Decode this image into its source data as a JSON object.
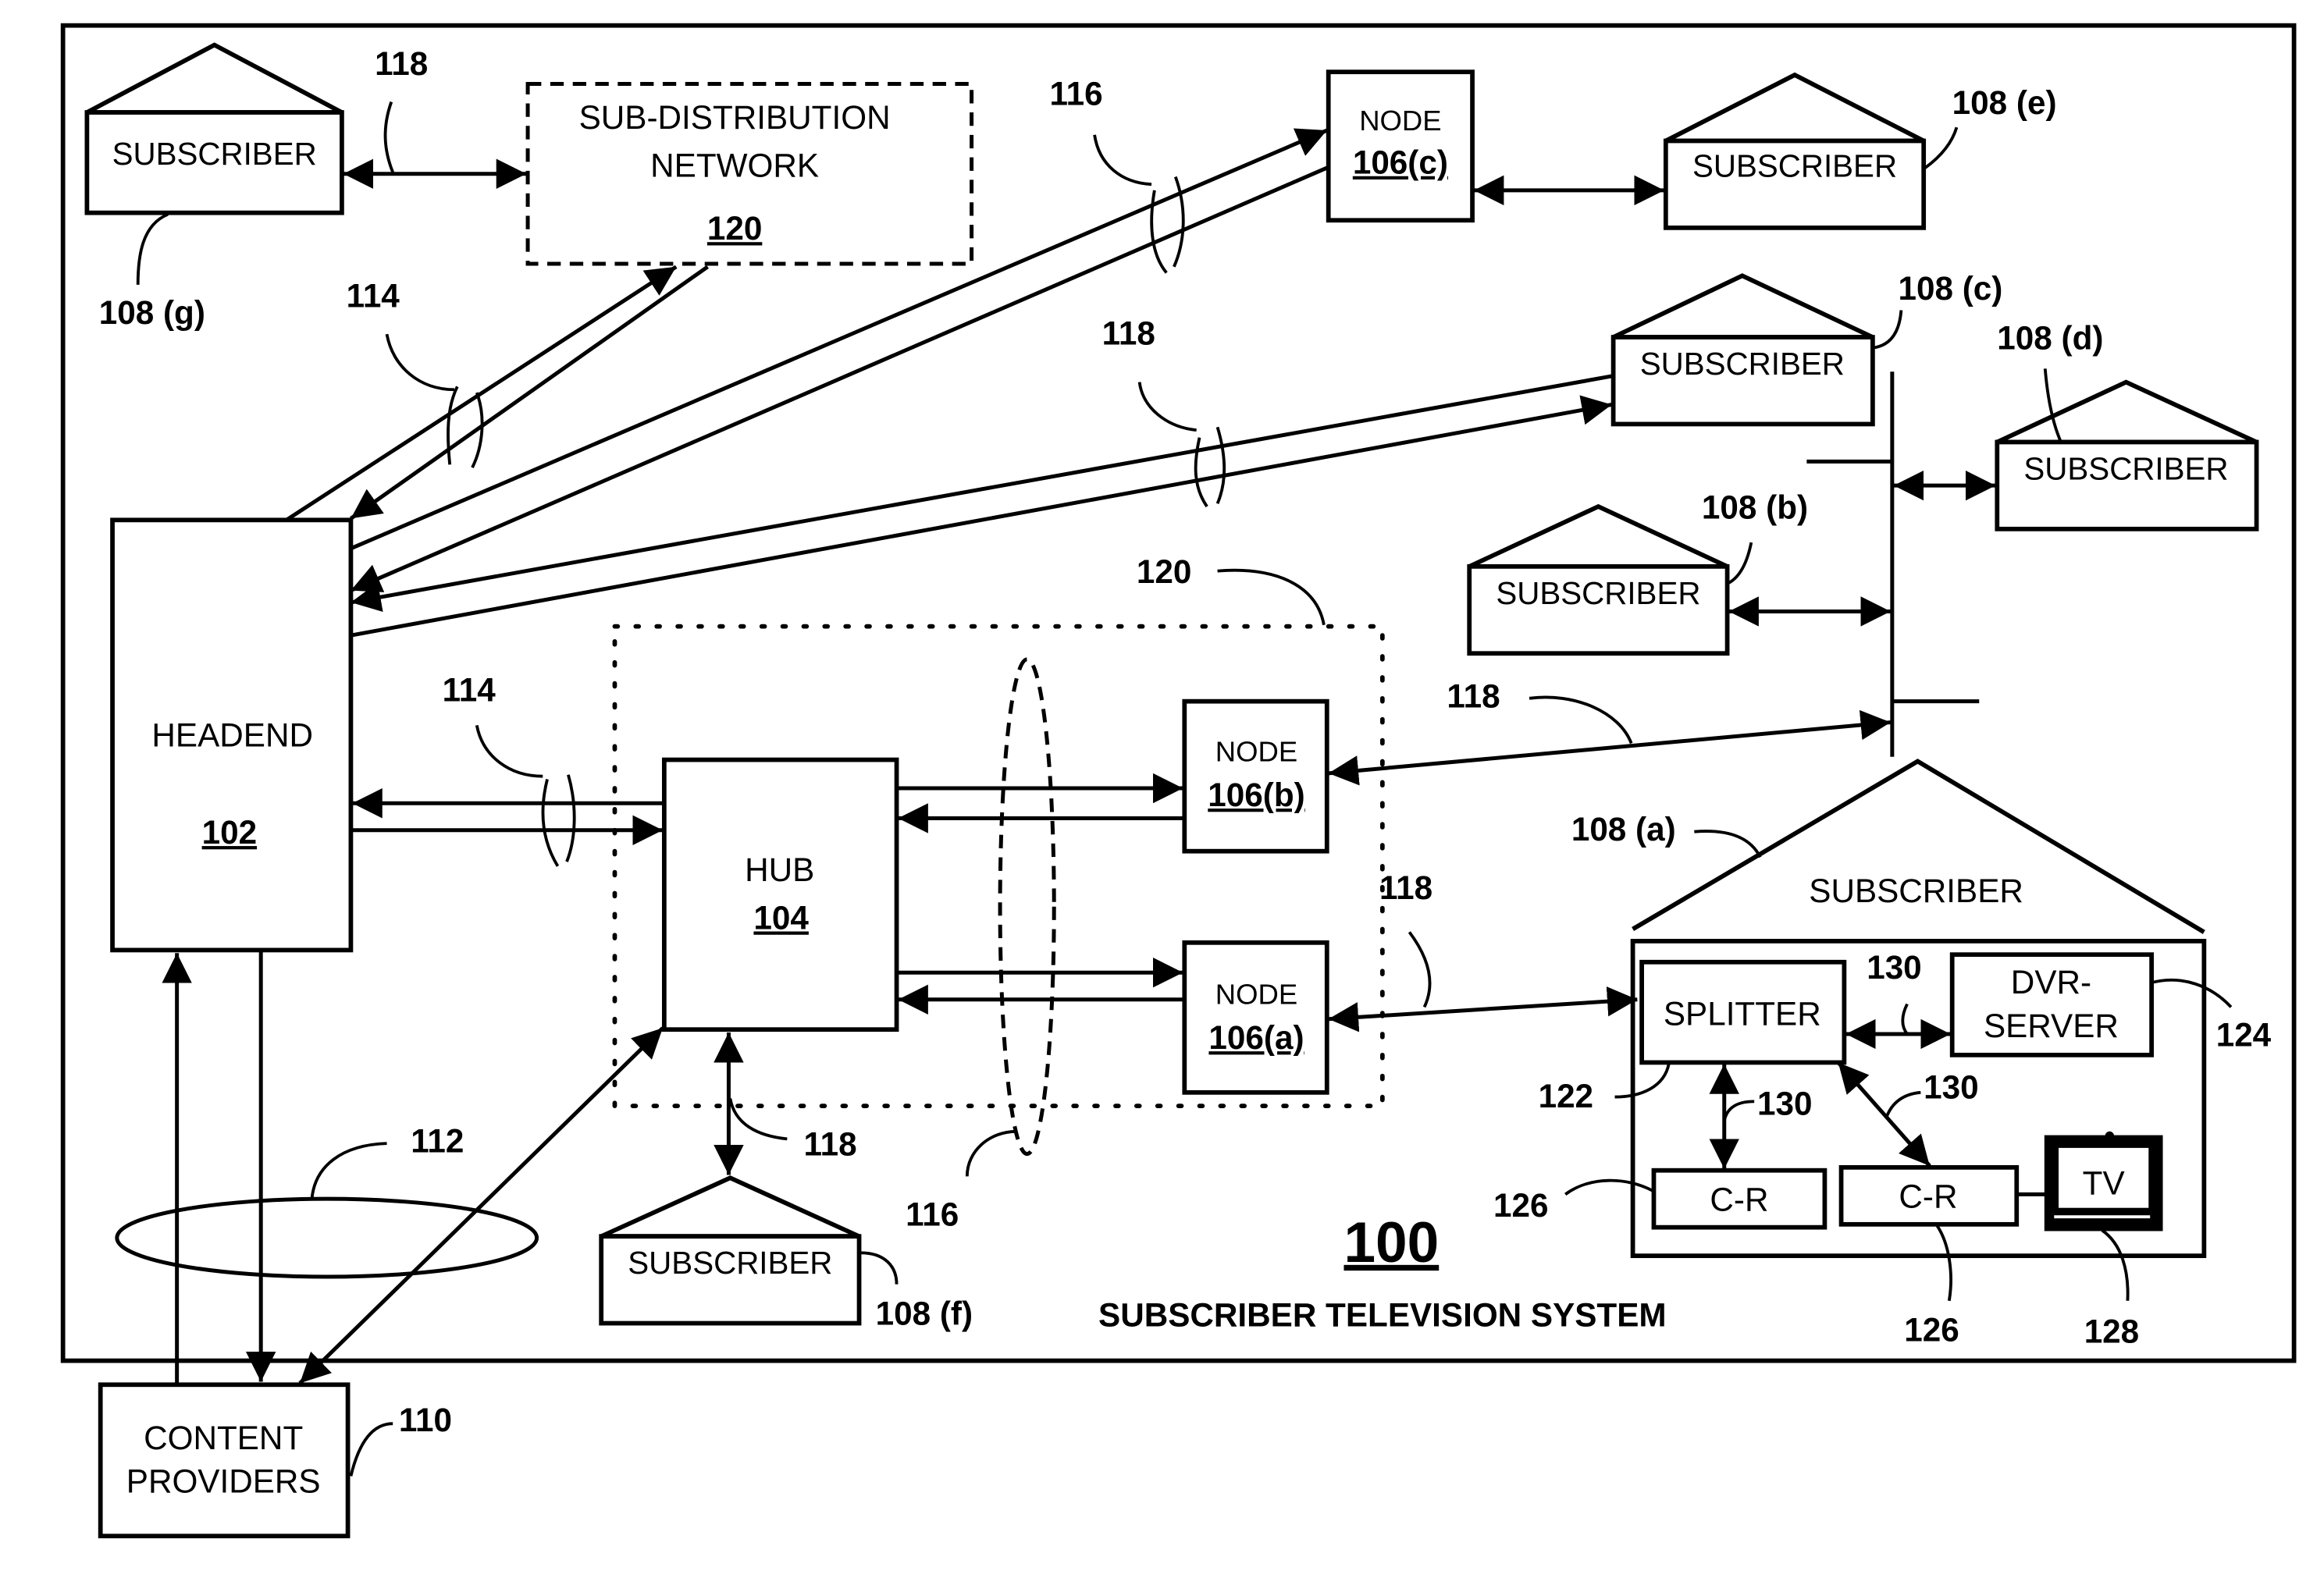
{
  "figure": {
    "system_number": "100",
    "system_title": "SUBSCRIBER TELEVISION SYSTEM"
  },
  "headend": {
    "label": "HEADEND",
    "ref": "102"
  },
  "hub": {
    "label": "HUB",
    "ref": "104"
  },
  "nodes": [
    {
      "label": "NODE",
      "ref": "106(c)"
    },
    {
      "label": "NODE",
      "ref": "106(b)"
    },
    {
      "label": "NODE",
      "ref": "106(a)"
    }
  ],
  "sub_distribution": {
    "line1": "SUB-DISTRIBUTION",
    "line2": "NETWORK",
    "ref": "120"
  },
  "content_providers": {
    "line1": "CONTENT",
    "line2": "PROVIDERS",
    "ref": "110"
  },
  "subscriber_label": "SUBSCRIBER",
  "subscribers": {
    "a": "108 (a)",
    "b": "108 (b)",
    "c": "108 (c)",
    "d": "108 (d)",
    "e": "108 (e)",
    "f": "108 (f)",
    "g": "108 (g)"
  },
  "home_devices": {
    "splitter": {
      "label": "SPLITTER",
      "ref": "122"
    },
    "dvr_server": {
      "line1": "DVR-",
      "line2": "SERVER",
      "ref": "124"
    },
    "cr_left": {
      "label": "C-R",
      "ref": "126"
    },
    "cr_right": {
      "label": "C-R",
      "ref": "126"
    },
    "tv": {
      "label": "TV",
      "ref": "128"
    },
    "link_ref": "130"
  },
  "refs": {
    "r112": "112",
    "r114": "114",
    "r116": "116",
    "r118": "118",
    "r120": "120"
  }
}
